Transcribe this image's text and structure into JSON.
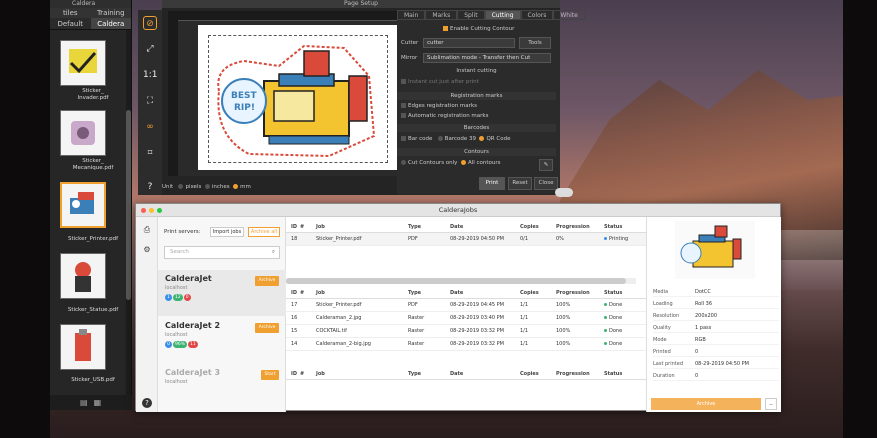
{
  "caldera": {
    "title": "Caldera",
    "tabs_top": [
      "tiles",
      "Training"
    ],
    "tabs": [
      "Default",
      "Caldera"
    ],
    "thumbs": [
      {
        "label": "Sticker_\nInvader.pdf"
      },
      {
        "label": "Sticker_\nMecanique.pdf"
      },
      {
        "label": "Sticker_Printer.pdf"
      },
      {
        "label": "Sticker_Statue.pdf"
      },
      {
        "label": "Sticker_USB.pdf"
      }
    ]
  },
  "page_setup": {
    "title": "Page Setup",
    "tabs": [
      "Main",
      "Marks",
      "Split",
      "Cutting",
      "Colors",
      "White"
    ],
    "active_tab": "Cutting",
    "enable_cutting": "Enable Cutting Contour",
    "cutter_label": "Cutter",
    "cutter_value": "cutter",
    "tools_btn": "Tools",
    "mirror_label": "Mirror",
    "mirror_value": "Sublimation mode - Transfer then Cut",
    "instant_section": "Instant cutting",
    "instant_option": "Instant cut just after print",
    "reg_section": "Registration marks",
    "reg_opts": [
      "Edges registration marks",
      "Automatic registration marks"
    ],
    "barcodes_section": "Barcodes",
    "barcode_opts": [
      "Bar code",
      "Barcode 39",
      "QR Code"
    ],
    "contours_section": "Contours",
    "contour_opts": [
      "Cut Contours only",
      "All contours"
    ],
    "unit_label": "Unit",
    "units": [
      "pixels",
      "inches",
      "mm"
    ],
    "print_btn": "Print",
    "reset_btn": "Reset",
    "close_btn": "Close"
  },
  "jobs": {
    "title": "CalderaJobs",
    "print_servers": "Print servers:",
    "import_jobs": "Import jobs",
    "archive_all": "Archive all",
    "search_placeholder": "Search",
    "printers": [
      {
        "name": "CalderaJet",
        "host": "localhost",
        "pills": [
          "1",
          "12",
          "0"
        ],
        "archive": "Archive"
      },
      {
        "name": "CalderaJet 2",
        "host": "localhost",
        "pills": [
          "0",
          "96%",
          "11"
        ],
        "archive": "Archive"
      },
      {
        "name": "CalderaJet 3",
        "host": "localhost",
        "pills": [],
        "archive": "Start"
      }
    ],
    "columns": [
      "ID",
      "#",
      "Job",
      "Type",
      "Date",
      "Copies",
      "Progression",
      "Status"
    ],
    "active": [
      {
        "id": "18",
        "job": "Sticker_Printer.pdf",
        "type": "PDF",
        "date": "08-29-2019 04:50 PM",
        "copies": "0/1",
        "prog": "0%",
        "status": "Printing"
      }
    ],
    "done": [
      {
        "id": "17",
        "job": "Sticker_Printer.pdf",
        "type": "PDF",
        "date": "08-29-2019 04:45 PM",
        "copies": "1/1",
        "prog": "100%",
        "status": "Done"
      },
      {
        "id": "16",
        "job": "Calderaman_2.jpg",
        "type": "Raster",
        "date": "08-29-2019 03:40 PM",
        "copies": "1/1",
        "prog": "100%",
        "status": "Done"
      },
      {
        "id": "15",
        "job": "COCKTAIL.tif",
        "type": "Raster",
        "date": "08-29-2019 03:32 PM",
        "copies": "1/1",
        "prog": "100%",
        "status": "Done"
      },
      {
        "id": "14",
        "job": "Calderaman_2-big.jpg",
        "type": "Raster",
        "date": "08-29-2019 03:32 PM",
        "copies": "1/1",
        "prog": "100%",
        "status": "Done"
      }
    ],
    "details": [
      {
        "k": "Media",
        "v": "DotCC"
      },
      {
        "k": "Loading",
        "v": "Roll 36"
      },
      {
        "k": "Resolution",
        "v": "200x200"
      },
      {
        "k": "Quality",
        "v": "1 pass"
      },
      {
        "k": "Mode",
        "v": "RGB"
      },
      {
        "k": "Printed",
        "v": "0"
      },
      {
        "k": "Last printed",
        "v": "08-29-2019 04:50 PM"
      },
      {
        "k": "Duration",
        "v": "0"
      }
    ],
    "details_archive": "Archive"
  },
  "colors": {
    "accent": "#f0a030",
    "done": "#3cb371",
    "printing": "#3a8ee6"
  }
}
